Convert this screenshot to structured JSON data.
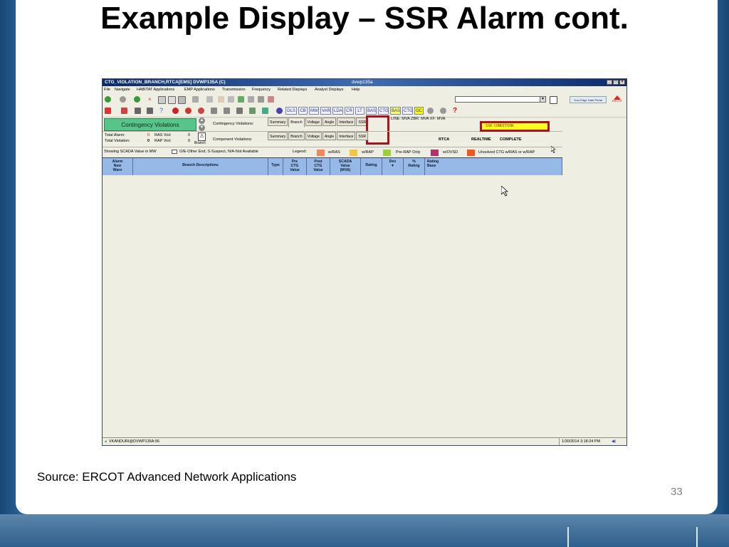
{
  "slide": {
    "title": "Example Display – SSR Alarm cont.",
    "source": "Source: ERCOT Advanced Network Applications",
    "page_number": "33"
  },
  "window": {
    "title": "CTG_VIOLATION_BRANCH,RTCA[EMS]  DVWP135A (C)",
    "overlay_title": "dvwp135a"
  },
  "menu": [
    "File",
    "Navigate",
    "HABITAT Applications",
    "EMP Applications",
    "Transmission",
    "Frequency",
    "Related Displays",
    "Analyst Displays",
    "Help"
  ],
  "toolbar2_buttons": [
    "DLS",
    "CB",
    "MW",
    "VAR",
    "LDA",
    "CR",
    "LT",
    "BAS",
    "CTG",
    "BAS",
    "CTG",
    "OC"
  ],
  "toolbar2_colors": {
    "BAS2": "#ffff66",
    "OC": "#ffff00"
  },
  "portal_link": "Your Edge Gate Portal",
  "ercot_label": "ERCOT",
  "panel": {
    "cv_button": "Contingency Violations",
    "contingency_label": "Contingency Violations:",
    "component_label": "Component Violations:",
    "branch_label": "Branch",
    "total_alarm_label": "Total Alarm:",
    "total_alarm_value": "0",
    "ras_viol_label": "RAS Viol:",
    "ras_viol_value": "0",
    "total_violation_label": "Total Violation:",
    "total_violation_value": "0",
    "rap_viol_label": "RAP Viol:",
    "rap_viol_value": "0",
    "tabs": [
      "Summary",
      "Branch",
      "Voltage",
      "Angle",
      "Interface",
      "SSR"
    ],
    "line_info": "LINE: MVA  ZBR: MVA  XF: MVA",
    "ssr_condition": "SSR CONDITION",
    "rtca": "RTCA",
    "realtime": "REALTIME",
    "complete": "COMPLETE",
    "scada_note": "Showing SCADA Value in MW",
    "flags_note": "O/E-Other End, S-Suspect, N/A-Not Available",
    "legend_label": "Legend:",
    "legend": [
      {
        "label": "w/RAS",
        "color": "#f5845a"
      },
      {
        "label": "w/RAP",
        "color": "#f4c542"
      },
      {
        "label": "Pre-RAP Only",
        "color": "#9ad13a"
      },
      {
        "label": "w/OVSD",
        "color": "#b3306a"
      },
      {
        "label": "Unsolved CTG w/RAS or w/RAP",
        "color": "#f0561f"
      }
    ]
  },
  "grid": {
    "columns": [
      "Alarm\nNew\nWarn",
      "Branch Descriptions",
      "Type",
      "Pre\nCTG\nValue",
      "Post\nCTG\nValue",
      "SCADA\nValue\n(MVA)",
      "Rating",
      "Dev\n▼",
      "%\nRating",
      "Rating\nBase"
    ]
  },
  "status": {
    "user": "VKANDURI@DVWP135A:56",
    "datetime": "1/30/2014 3:18:24 PM"
  }
}
